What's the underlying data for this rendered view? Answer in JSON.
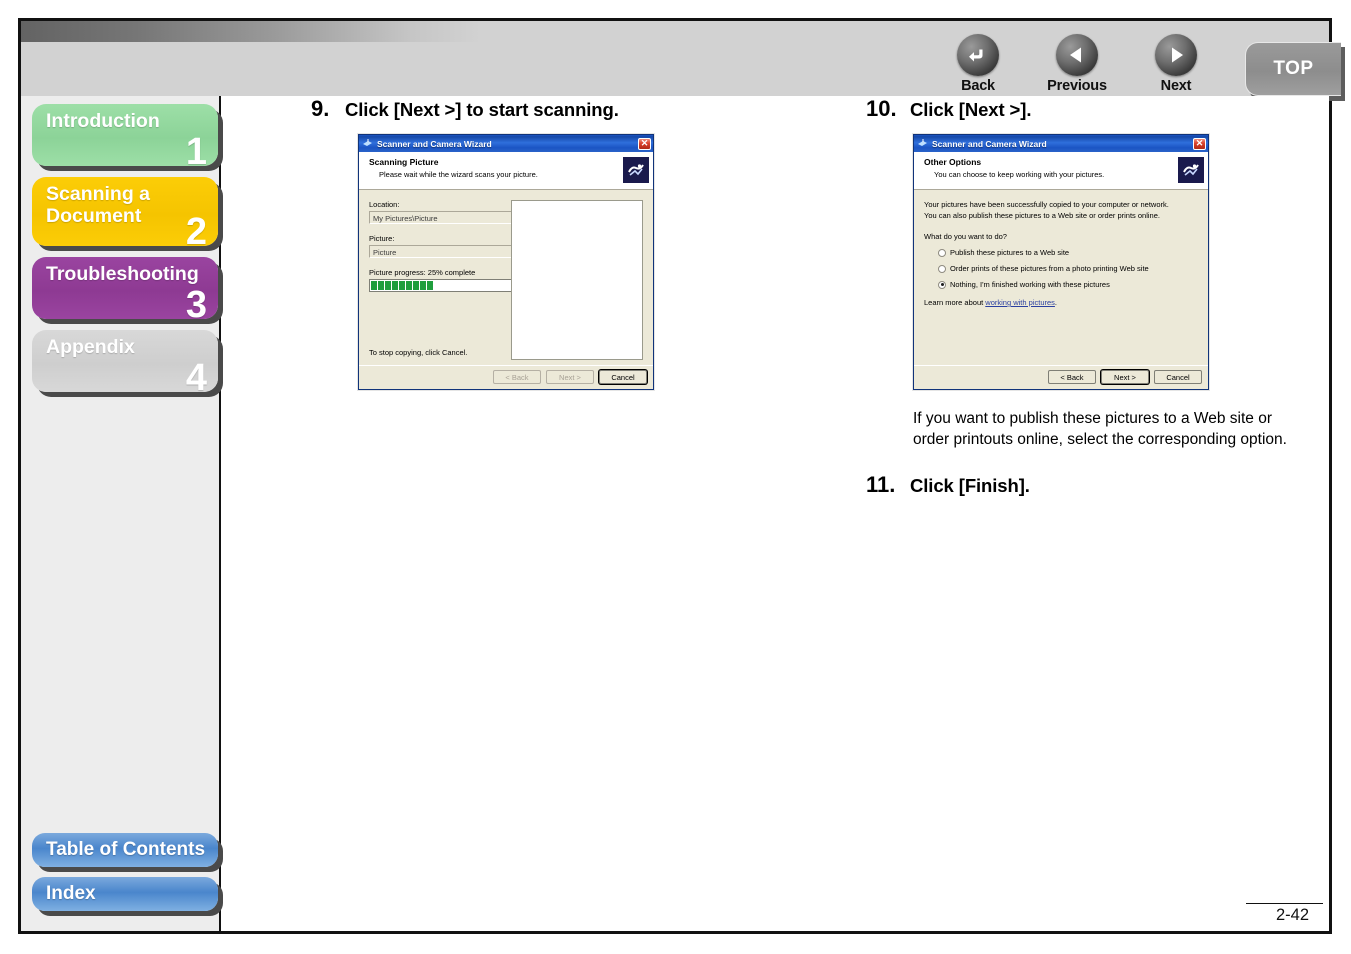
{
  "header": {
    "nav": [
      {
        "label": "Back",
        "icon": "back-arrow-icon"
      },
      {
        "label": "Previous",
        "icon": "left-triangle-icon"
      },
      {
        "label": "Next",
        "icon": "right-triangle-icon"
      }
    ],
    "top_tab_label": "TOP"
  },
  "sidebar": {
    "chapters": [
      {
        "label": "Introduction",
        "number": "1",
        "color": "#8cd398"
      },
      {
        "label": "Scanning a\nDocument",
        "number": "2",
        "color": "#f5c400"
      },
      {
        "label": "Troubleshooting",
        "number": "3",
        "color": "#8e3a93"
      },
      {
        "label": "Appendix",
        "number": "4",
        "color": "#cecece"
      }
    ],
    "bottom": [
      {
        "label": "Table of Contents"
      },
      {
        "label": "Index"
      }
    ]
  },
  "content": {
    "steps": [
      {
        "number": "9.",
        "text": "Click [Next >] to start scanning."
      },
      {
        "number": "10.",
        "text": "Click [Next >]."
      },
      {
        "number": "11.",
        "text": "Click [Finish]."
      }
    ],
    "note": "If you want to publish these pictures to a Web site or order printouts online, select the corresponding option."
  },
  "dialog_scanning": {
    "title": "Scanner and Camera Wizard",
    "close_label": "✕",
    "heading": "Scanning Picture",
    "subheading": "Please wait while the wizard scans your picture.",
    "location_label": "Location:",
    "location_value": "My Pictures\\Picture",
    "picture_label": "Picture:",
    "picture_value": "Picture",
    "progress_label": "Picture progress: 25% complete",
    "progress_percent": 25,
    "stop_note": "To stop copying, click Cancel.",
    "buttons": [
      {
        "label": "< Back",
        "state": "disabled"
      },
      {
        "label": "Next >",
        "state": "disabled"
      },
      {
        "label": "Cancel",
        "state": "focus"
      }
    ]
  },
  "dialog_other_options": {
    "title": "Scanner and Camera Wizard",
    "close_label": "✕",
    "heading": "Other Options",
    "subheading": "You can choose to keep working with your pictures.",
    "paragraph_line1": "Your pictures have been successfully copied to your computer or network.",
    "paragraph_line2": "You can also publish these pictures to a Web site or order prints online.",
    "question": "What do you want to do?",
    "options": [
      {
        "label": "Publish these pictures to a Web site",
        "selected": false
      },
      {
        "label": "Order prints of these pictures from a photo printing Web site",
        "selected": false
      },
      {
        "label": "Nothing, I'm finished working with these pictures",
        "selected": true
      }
    ],
    "learn_prefix": "Learn more about ",
    "learn_link": "working with pictures",
    "learn_suffix": ".",
    "buttons": [
      {
        "label": "< Back",
        "state": "enabled"
      },
      {
        "label": "Next >",
        "state": "focus"
      },
      {
        "label": "Cancel",
        "state": "enabled"
      }
    ]
  },
  "footer": {
    "page_number": "2-42"
  }
}
